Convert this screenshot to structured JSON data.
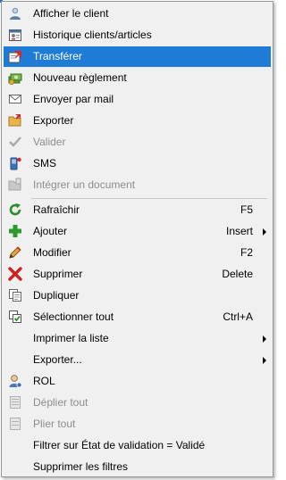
{
  "menu": {
    "items": [
      {
        "label": "Afficher le client",
        "icon": "customer-icon",
        "enabled": true
      },
      {
        "label": "Historique clients/articles",
        "icon": "history-icon",
        "enabled": true
      },
      {
        "label": "Transférer",
        "icon": "transfer-icon",
        "enabled": true,
        "highlighted": true
      },
      {
        "label": "Nouveau règlement",
        "icon": "payment-icon",
        "enabled": true
      },
      {
        "label": "Envoyer par mail",
        "icon": "mail-icon",
        "enabled": true
      },
      {
        "label": "Exporter",
        "icon": "export-folder-icon",
        "enabled": true
      },
      {
        "label": "Valider",
        "icon": "check-icon",
        "enabled": false
      },
      {
        "label": "SMS",
        "icon": "phone-icon",
        "enabled": true
      },
      {
        "label": "Intégrer un document",
        "icon": "folder-icon",
        "enabled": false
      },
      {
        "label": "Rafraîchir",
        "icon": "refresh-icon",
        "enabled": true,
        "shortcut": "F5"
      },
      {
        "label": "Ajouter",
        "icon": "plus-icon",
        "enabled": true,
        "shortcut": "Insert",
        "submenu": true
      },
      {
        "label": "Modifier",
        "icon": "pencil-icon",
        "enabled": true,
        "shortcut": "F2"
      },
      {
        "label": "Supprimer",
        "icon": "delete-icon",
        "enabled": true,
        "shortcut": "Delete"
      },
      {
        "label": "Dupliquer",
        "icon": "duplicate-icon",
        "enabled": true
      },
      {
        "label": "Sélectionner tout",
        "icon": "select-all-icon",
        "enabled": true,
        "shortcut": "Ctrl+A"
      },
      {
        "label": "Imprimer la liste",
        "icon": "",
        "enabled": true,
        "submenu": true
      },
      {
        "label": "Exporter...",
        "icon": "",
        "enabled": true,
        "submenu": true
      },
      {
        "label": "ROL",
        "icon": "user-icon",
        "enabled": true
      },
      {
        "label": "Déplier tout",
        "icon": "expand-icon",
        "enabled": false
      },
      {
        "label": "Plier tout",
        "icon": "collapse-icon",
        "enabled": false
      },
      {
        "label": "Filtrer sur État de validation = Validé",
        "icon": "",
        "enabled": true
      },
      {
        "label": "Supprimer les filtres",
        "icon": "",
        "enabled": true
      }
    ]
  },
  "colors": {
    "highlight": "#1e7bd6",
    "menu_background": "#f0f0f0",
    "disabled_text": "#8d8d8d",
    "border": "#979797"
  }
}
